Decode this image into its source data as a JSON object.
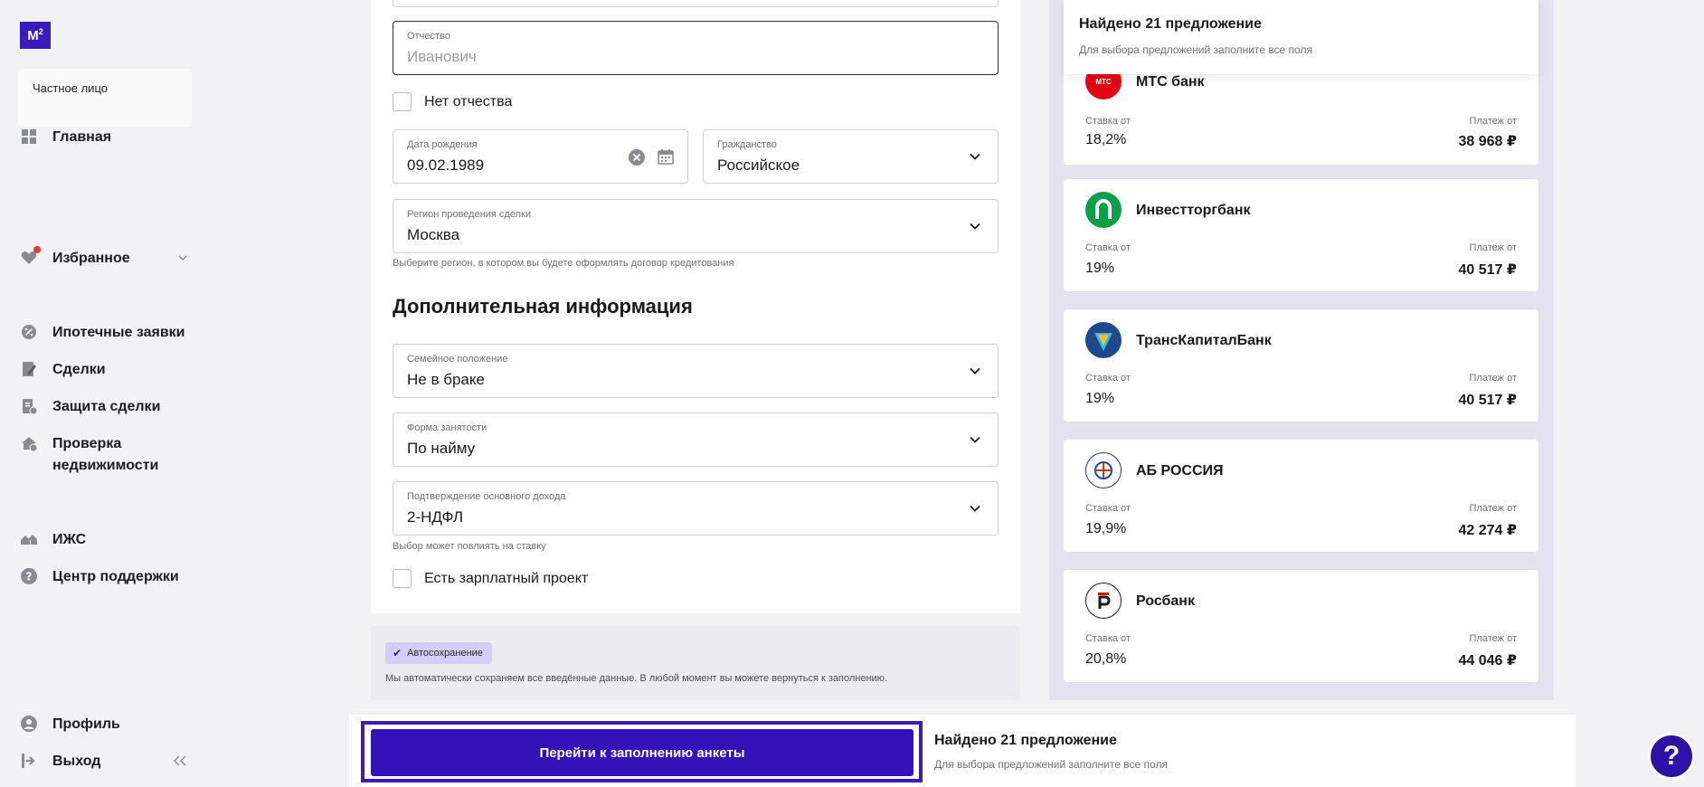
{
  "logo": {
    "text": "M",
    "sup": "2"
  },
  "account": {
    "type": "Частное лицо"
  },
  "nav": {
    "home": "Главная",
    "favorites": "Избранное",
    "mortgage": "Ипотечные заявки",
    "deals": "Сделки",
    "protection": "Защита сделки",
    "check_line1": "Проверка",
    "check_line2": "недвижимости",
    "izhs": "ИЖС",
    "support": "Центр поддержки",
    "profile": "Профиль",
    "logout": "Выход"
  },
  "form": {
    "patronymic": {
      "label": "Отчество",
      "placeholder": "Иванович"
    },
    "no_patronymic": "Нет отчества",
    "birthdate": {
      "label": "Дата рождения",
      "value": "09.02.1989"
    },
    "citizenship": {
      "label": "Гражданство",
      "value": "Российское"
    },
    "region": {
      "label": "Регион проведения сделки",
      "value": "Москва",
      "hint": "Выберите регион, в котором вы будете оформлять договор кредитования"
    },
    "section_title": "Дополнительная информация",
    "marital": {
      "label": "Семейное положение",
      "value": "Не в браке"
    },
    "employment": {
      "label": "Форма занятости",
      "value": "По найму"
    },
    "income": {
      "label": "Подтверждение основного дохода",
      "value": "2-НДФЛ",
      "hint": "Выбор может повлиять на ставку"
    },
    "salary_project": "Есть зарплатный проект"
  },
  "autosave": {
    "badge": "Автосохранение",
    "text": "Мы автоматически сохраняем все введённые данные. В любой момент вы можете вернуться к заполнению."
  },
  "offers": {
    "title": "Найдено 21 предложение",
    "subtitle": "Для выбора предложений заполните все поля",
    "rate_label": "Ставка от",
    "pay_label": "Платеж от",
    "banks": [
      {
        "name": "МТС банк",
        "rate": "18,2%",
        "payment": "38 968 ₽",
        "logo_text": "МТС"
      },
      {
        "name": "Инвестторгбанк",
        "rate": "19%",
        "payment": "40 517 ₽"
      },
      {
        "name": "ТрансКапиталБанк",
        "rate": "19%",
        "payment": "40 517 ₽"
      },
      {
        "name": "АБ РОССИЯ",
        "rate": "19,9%",
        "payment": "42 274 ₽"
      },
      {
        "name": "Росбанк",
        "rate": "20,8%",
        "payment": "44 046 ₽"
      }
    ]
  },
  "bottom": {
    "cta": "Перейти к заполнению анкеты",
    "title": "Найдено 21 предложение",
    "subtitle": "Для выбора предложений заполните все поля"
  },
  "help": {
    "label": "?"
  },
  "colors": {
    "accent": "#3312b8",
    "mts_red": "#e30611",
    "invest_green": "#0aa04a",
    "tkb_blue": "#1e4a8c"
  }
}
